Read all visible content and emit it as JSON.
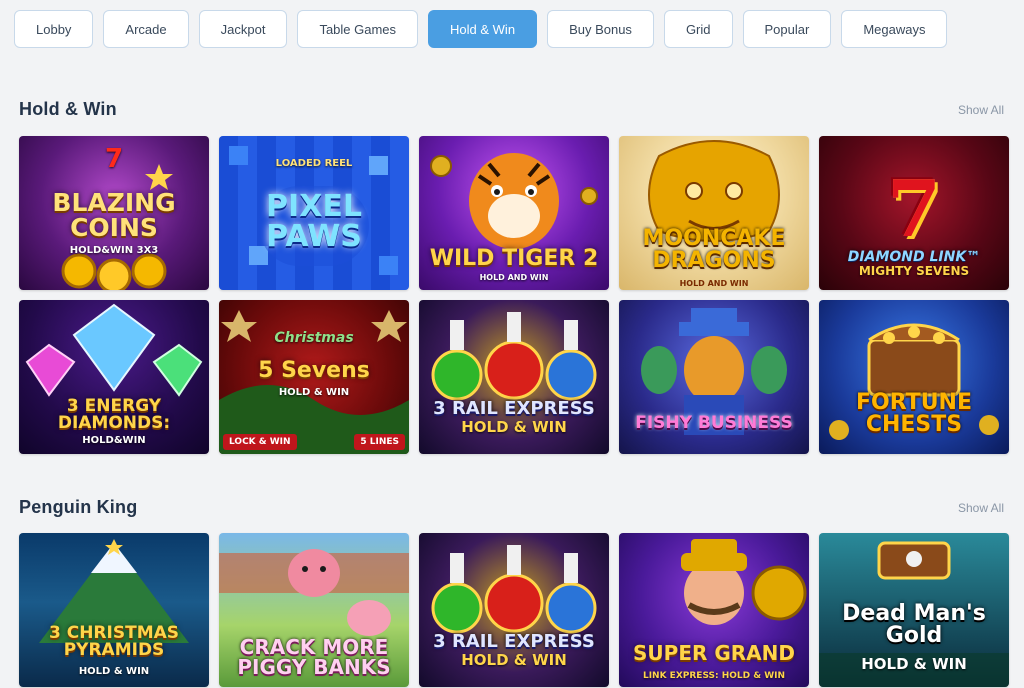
{
  "tabs": [
    {
      "label": "Lobby",
      "active": false
    },
    {
      "label": "Arcade",
      "active": false
    },
    {
      "label": "Jackpot",
      "active": false
    },
    {
      "label": "Table Games",
      "active": false
    },
    {
      "label": "Hold & Win",
      "active": true
    },
    {
      "label": "Buy Bonus",
      "active": false
    },
    {
      "label": "Grid",
      "active": false
    },
    {
      "label": "Popular",
      "active": false
    },
    {
      "label": "Megaways",
      "active": false
    }
  ],
  "sections": [
    {
      "title": "Hold & Win",
      "show_all": "Show All",
      "games": [
        {
          "top": "7",
          "title": "BLAZING COINS",
          "sub": "HOLD&WIN 3X3",
          "tags": []
        },
        {
          "top": "LOADED REEL",
          "title": "PIXEL PAWS",
          "sub": "",
          "tags": []
        },
        {
          "top": "",
          "title": "WILD TIGER 2",
          "sub": "HOLD AND WIN",
          "tags": []
        },
        {
          "top": "",
          "title": "MOONCAKE DRAGONS",
          "sub": "HOLD AND WIN",
          "tags": []
        },
        {
          "top": "7",
          "title": "DIAMOND LINK™",
          "sub": "MIGHTY SEVENS",
          "tags": []
        },
        {
          "top": "",
          "title": "3 ENERGY DIAMONDS:",
          "sub": "HOLD&WIN",
          "tags": []
        },
        {
          "top": "Christmas",
          "title": "5 Sevens",
          "sub": "HOLD & WIN",
          "tags": [
            "LOCK & WIN",
            "5 LINES"
          ]
        },
        {
          "top": "",
          "title": "3 RAIL EXPRESS",
          "sub": "HOLD & WIN",
          "tags": []
        },
        {
          "top": "",
          "title": "FISHY BUSINESS",
          "sub": "",
          "tags": []
        },
        {
          "top": "",
          "title": "FORTUNE CHESTS",
          "sub": "",
          "tags": []
        }
      ]
    },
    {
      "title": "Penguin King",
      "show_all": "Show All",
      "games": [
        {
          "top": "",
          "title": "3 CHRISTMAS PYRAMIDS",
          "sub": "HOLD & WIN",
          "tags": []
        },
        {
          "top": "",
          "title": "CRACK MORE PIGGY BANKS",
          "sub": "",
          "tags": []
        },
        {
          "top": "",
          "title": "3 RAIL EXPRESS",
          "sub": "HOLD & WIN",
          "tags": []
        },
        {
          "top": "",
          "title": "SUPER GRAND",
          "sub": "LINK EXPRESS: HOLD & WIN",
          "tags": []
        },
        {
          "top": "",
          "title": "Dead Man's Gold",
          "sub": "HOLD & WIN",
          "tags": []
        }
      ]
    }
  ],
  "theme": {
    "accent": "#4a9ee2",
    "tab_border": "#c8d9ea",
    "background": "#f2f3f5",
    "show_all_color": "#8a96a6"
  }
}
